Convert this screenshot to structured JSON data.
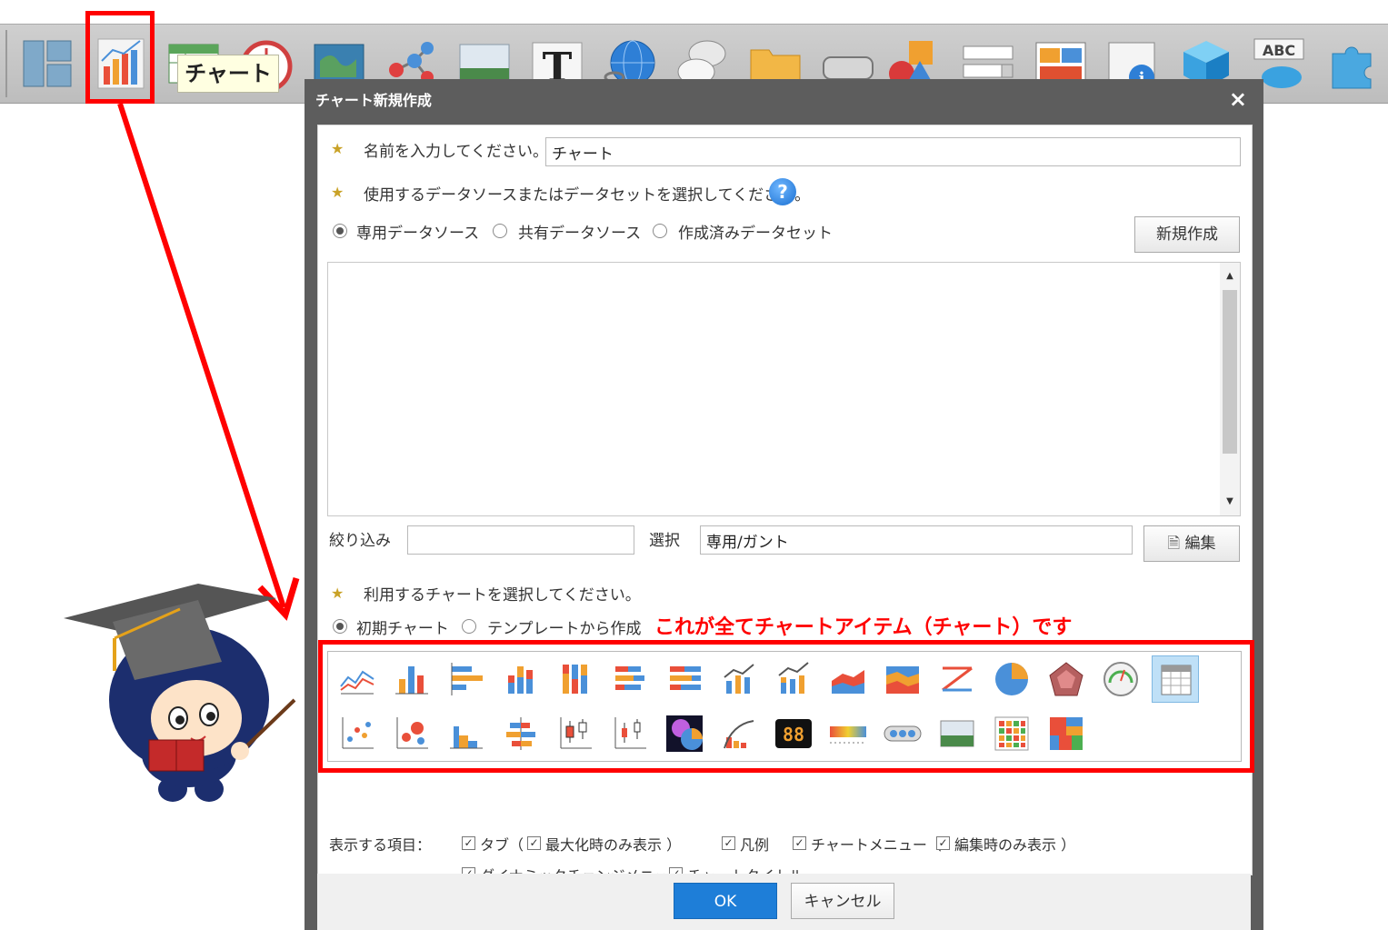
{
  "toolbar": {
    "icons": [
      "layout-icon",
      "chart-icon",
      "table-icon",
      "gauge-icon",
      "map-icon",
      "network-icon",
      "image-icon",
      "text-icon",
      "web-link-icon",
      "comment-icon",
      "folder-icon",
      "button-icon",
      "shape-icon",
      "select-box-icon",
      "panel-icon",
      "info-icon",
      "cube-icon",
      "abc-cloud-icon",
      "plugin-icon"
    ],
    "tooltip": "チャート"
  },
  "dialog": {
    "title": "チャート新規作成",
    "close": "×",
    "name_label": "名前を入力してください。",
    "name_value": "チャート",
    "datasource_label": "使用するデータソースまたはデータセットを選択してください。",
    "help": "?",
    "datasource_options": [
      "専用データソース",
      "共有データソース",
      "作成済みデータセット"
    ],
    "datasource_selected": 0,
    "new_button": "新規作成",
    "filter_label": "絞り込み",
    "filter_value": "",
    "select_label": "選択",
    "select_value": "専用/ガント",
    "edit_button": "編集",
    "chart_label": "利用するチャートを選択してください。",
    "chart_options": [
      "初期チャート",
      "テンプレートから作成"
    ],
    "chart_option_selected": 0,
    "annotation": "これが全てチャートアイテム（チャート）です",
    "chart_types_row1": [
      "line-chart-icon",
      "bar-chart-icon",
      "horizontal-bar-icon",
      "stacked-bar-icon",
      "stacked-bar-100-icon",
      "stacked-hbar-icon",
      "stacked-hbar-100-icon",
      "bar-line-combo-icon",
      "stacked-line-combo-icon",
      "area-chart-icon",
      "stacked-area-icon",
      "z-chart-icon",
      "pie-chart-icon",
      "radar-chart-icon",
      "meter-icon",
      "table-chart-icon"
    ],
    "chart_types_row2": [
      "scatter-icon",
      "bubble-icon",
      "step-icon",
      "butterfly-icon",
      "box-plot-icon",
      "candlestick-icon",
      "planet-icon",
      "pareto-icon",
      "digital-number-icon",
      "heat-bar-icon",
      "signal-icon",
      "image-chart-icon",
      "heatmap-icon",
      "treemap-icon"
    ],
    "selected_chart_type": "table-chart-icon",
    "display_label": "表示する項目：",
    "display_items": [
      {
        "label": "タブ（",
        "checked": true
      },
      {
        "label": "最大化時のみ表示 ）",
        "checked": true
      },
      {
        "label": "凡例",
        "checked": true
      },
      {
        "label": "チャートメニュー（",
        "checked": true
      },
      {
        "label": "編集時のみ表示 ）",
        "checked": true
      },
      {
        "label": "ダイナミックチェンジメニュー",
        "checked": true
      },
      {
        "label": "チャートタイトル",
        "checked": true
      }
    ],
    "ok": "OK",
    "cancel": "キャンセル"
  },
  "colors": {
    "highlight": "#ff0000",
    "ok_blue": "#1e7ed8",
    "title_bar": "#5d5d5d"
  }
}
